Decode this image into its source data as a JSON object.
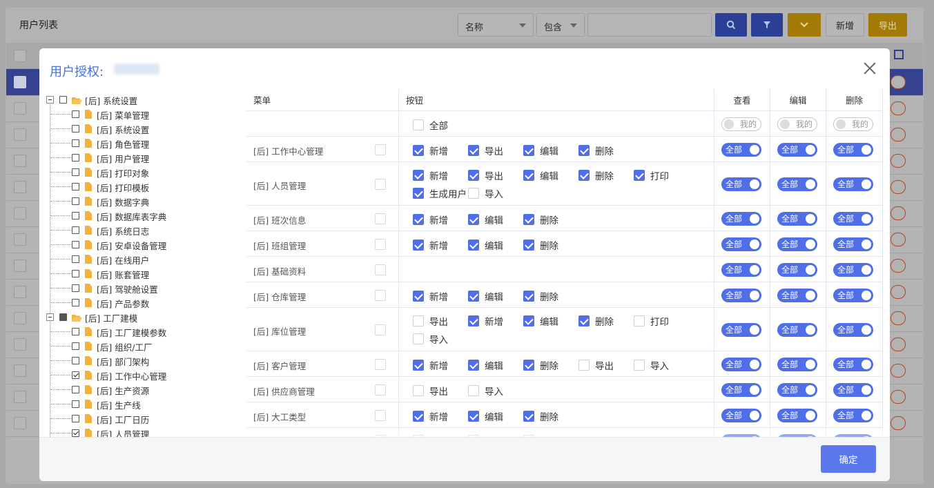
{
  "background": {
    "page_title": "用户列表",
    "filter_field": "名称",
    "filter_op": "包含",
    "buttons": {
      "add": "新增",
      "export": "导出"
    }
  },
  "modal": {
    "title": "用户授权:",
    "confirm": "确定"
  },
  "tree": [
    {
      "label": "[后] 系统设置",
      "level": 0,
      "type": "folder",
      "check": "none"
    },
    {
      "label": "[后] 菜单管理",
      "level": 1,
      "check": "none"
    },
    {
      "label": "[后] 系统设置",
      "level": 1,
      "check": "none"
    },
    {
      "label": "[后] 角色管理",
      "level": 1,
      "check": "none"
    },
    {
      "label": "[后] 用户管理",
      "level": 1,
      "check": "none"
    },
    {
      "label": "[后] 打印对象",
      "level": 1,
      "check": "none"
    },
    {
      "label": "[后] 打印模板",
      "level": 1,
      "check": "none"
    },
    {
      "label": "[后] 数据字典",
      "level": 1,
      "check": "none"
    },
    {
      "label": "[后] 数据库表字典",
      "level": 1,
      "check": "none"
    },
    {
      "label": "[后] 系统日志",
      "level": 1,
      "check": "none"
    },
    {
      "label": "[后] 安卓设备管理",
      "level": 1,
      "check": "none"
    },
    {
      "label": "[后] 在线用户",
      "level": 1,
      "check": "none"
    },
    {
      "label": "[后] 账套管理",
      "level": 1,
      "check": "none"
    },
    {
      "label": "[后] 驾驶舱设置",
      "level": 1,
      "check": "none"
    },
    {
      "label": "[后] 产品参数",
      "level": 1,
      "check": "none"
    },
    {
      "label": "[后] 工厂建模",
      "level": 0,
      "type": "folder",
      "check": "half"
    },
    {
      "label": "[后] 工厂建模参数",
      "level": 1,
      "check": "none"
    },
    {
      "label": "[后] 组织/工厂",
      "level": 1,
      "check": "none"
    },
    {
      "label": "[后] 部门架构",
      "level": 1,
      "check": "none"
    },
    {
      "label": "[后] 工作中心管理",
      "level": 1,
      "check": "on"
    },
    {
      "label": "[后] 生产资源",
      "level": 1,
      "check": "none"
    },
    {
      "label": "[后] 生产线",
      "level": 1,
      "check": "none"
    },
    {
      "label": "[后] 工厂日历",
      "level": 1,
      "check": "none"
    },
    {
      "label": "[后] 人员管理",
      "level": 1,
      "check": "on"
    }
  ],
  "table": {
    "headers": {
      "menu": "菜单",
      "buttons": "按钮",
      "view": "查看",
      "edit": "编辑",
      "delete": "删除"
    },
    "all_label": "全部",
    "mine_label": "我的",
    "rows": [
      {
        "name": "[后] 工作中心管理",
        "buttons": [
          [
            "新增",
            true
          ],
          [
            "导出",
            true
          ],
          [
            "编辑",
            true
          ],
          [
            "删除",
            true
          ]
        ]
      },
      {
        "name": "[后] 人员管理",
        "buttons": [
          [
            "新增",
            true
          ],
          [
            "导出",
            true
          ],
          [
            "编辑",
            true
          ],
          [
            "删除",
            true
          ],
          [
            "打印",
            true
          ],
          [
            "生成用户",
            true
          ],
          [
            "导入",
            false
          ]
        ]
      },
      {
        "name": "[后] 班次信息",
        "buttons": [
          [
            "新增",
            true
          ],
          [
            "编辑",
            true
          ],
          [
            "删除",
            true
          ]
        ]
      },
      {
        "name": "[后] 班组管理",
        "buttons": [
          [
            "新增",
            true
          ],
          [
            "编辑",
            true
          ],
          [
            "删除",
            true
          ]
        ]
      },
      {
        "name": "[后] 基础资料",
        "buttons": []
      },
      {
        "name": "[后] 仓库管理",
        "buttons": [
          [
            "新增",
            true
          ],
          [
            "编辑",
            true
          ],
          [
            "删除",
            true
          ]
        ]
      },
      {
        "name": "[后] 库位管理",
        "buttons": [
          [
            "导出",
            false
          ],
          [
            "新增",
            true
          ],
          [
            "编辑",
            true
          ],
          [
            "删除",
            true
          ],
          [
            "打印",
            false
          ],
          [
            "导入",
            false
          ]
        ]
      },
      {
        "name": "[后] 客户管理",
        "buttons": [
          [
            "新增",
            true
          ],
          [
            "编辑",
            true
          ],
          [
            "删除",
            true
          ],
          [
            "导出",
            false
          ],
          [
            "导入",
            false
          ]
        ]
      },
      {
        "name": "[后] 供应商管理",
        "buttons": [
          [
            "导出",
            false
          ],
          [
            "导入",
            false
          ]
        ]
      },
      {
        "name": "[后] 大工类型",
        "buttons": [
          [
            "新增",
            true
          ],
          [
            "编辑",
            true
          ],
          [
            "删除",
            true
          ]
        ]
      }
    ]
  }
}
